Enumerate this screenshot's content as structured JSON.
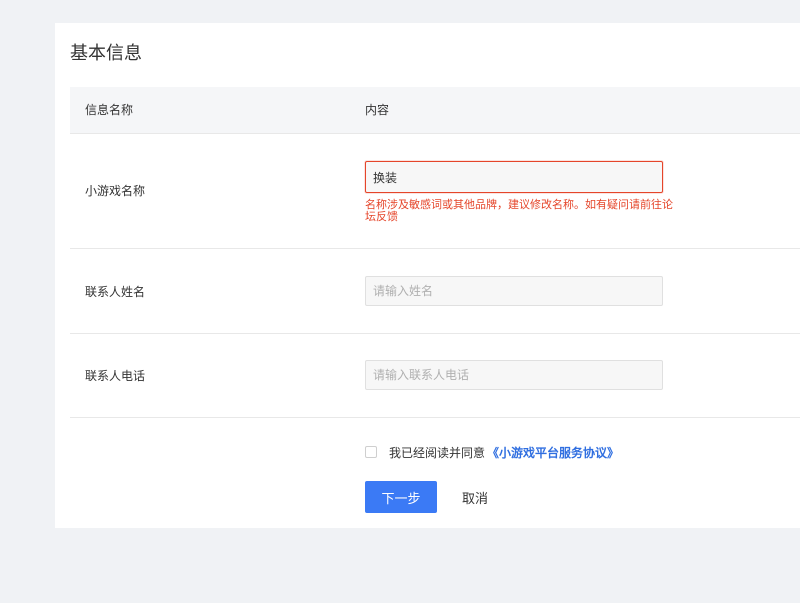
{
  "panel": {
    "title": "基本信息"
  },
  "table": {
    "col_name": "信息名称",
    "col_content": "内容"
  },
  "rows": [
    {
      "label": "小游戏名称",
      "value": "换装",
      "placeholder": "",
      "error": "名称涉及敏感词或其他品牌，建议修改名称。如有疑问请前往论坛反馈"
    },
    {
      "label": "联系人姓名",
      "value": "",
      "placeholder": "请输入姓名"
    },
    {
      "label": "联系人电话",
      "value": "",
      "placeholder": "请输入联系人电话"
    }
  ],
  "agreement": {
    "text": "我已经阅读并同意",
    "link": "《小游戏平台服务协议》",
    "checked": false
  },
  "actions": {
    "next": "下一步",
    "cancel": "取消"
  },
  "colors": {
    "primary": "#3b7af5",
    "link": "#2f6ee0",
    "error": "#e5452a"
  }
}
